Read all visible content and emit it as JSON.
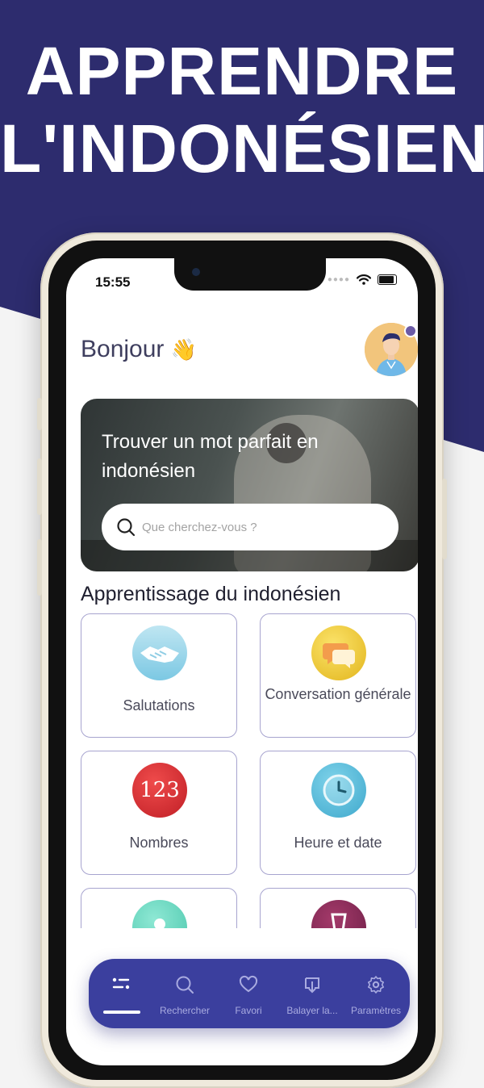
{
  "banner": {
    "line1": "APPRENDRE",
    "line2": "L'INDONÉSIEN"
  },
  "status_bar": {
    "time": "15:55"
  },
  "header": {
    "greeting": "Bonjour",
    "greeting_emoji": "👋"
  },
  "hero": {
    "title": "Trouver un mot parfait en indonésien",
    "search_placeholder": "Que cherchez-vous ?"
  },
  "section": {
    "title": "Apprentissage du indonésien"
  },
  "categories": [
    {
      "label": "Salutations",
      "icon": "handshake-icon"
    },
    {
      "label": "Conversation générale",
      "icon": "speech-bubbles-icon"
    },
    {
      "label": "Nombres",
      "icon": "numbers-123-icon",
      "icon_text": "123"
    },
    {
      "label": "Heure et date",
      "icon": "clock-icon"
    },
    {
      "label": "",
      "icon": "location-pin-icon"
    },
    {
      "label": "",
      "icon": "drink-glass-icon"
    }
  ],
  "nav": {
    "items": [
      {
        "label": "",
        "icon": "list-icon",
        "active": true
      },
      {
        "label": "Rechercher",
        "icon": "search-icon"
      },
      {
        "label": "Favori",
        "icon": "heart-icon"
      },
      {
        "label": "Balayer la...",
        "icon": "download-icon"
      },
      {
        "label": "Paramètres",
        "icon": "gear-icon"
      }
    ]
  },
  "colors": {
    "banner_bg": "#2d2c6e",
    "nav_bg": "#3b3f9e",
    "card_border": "#a7a4cf"
  }
}
